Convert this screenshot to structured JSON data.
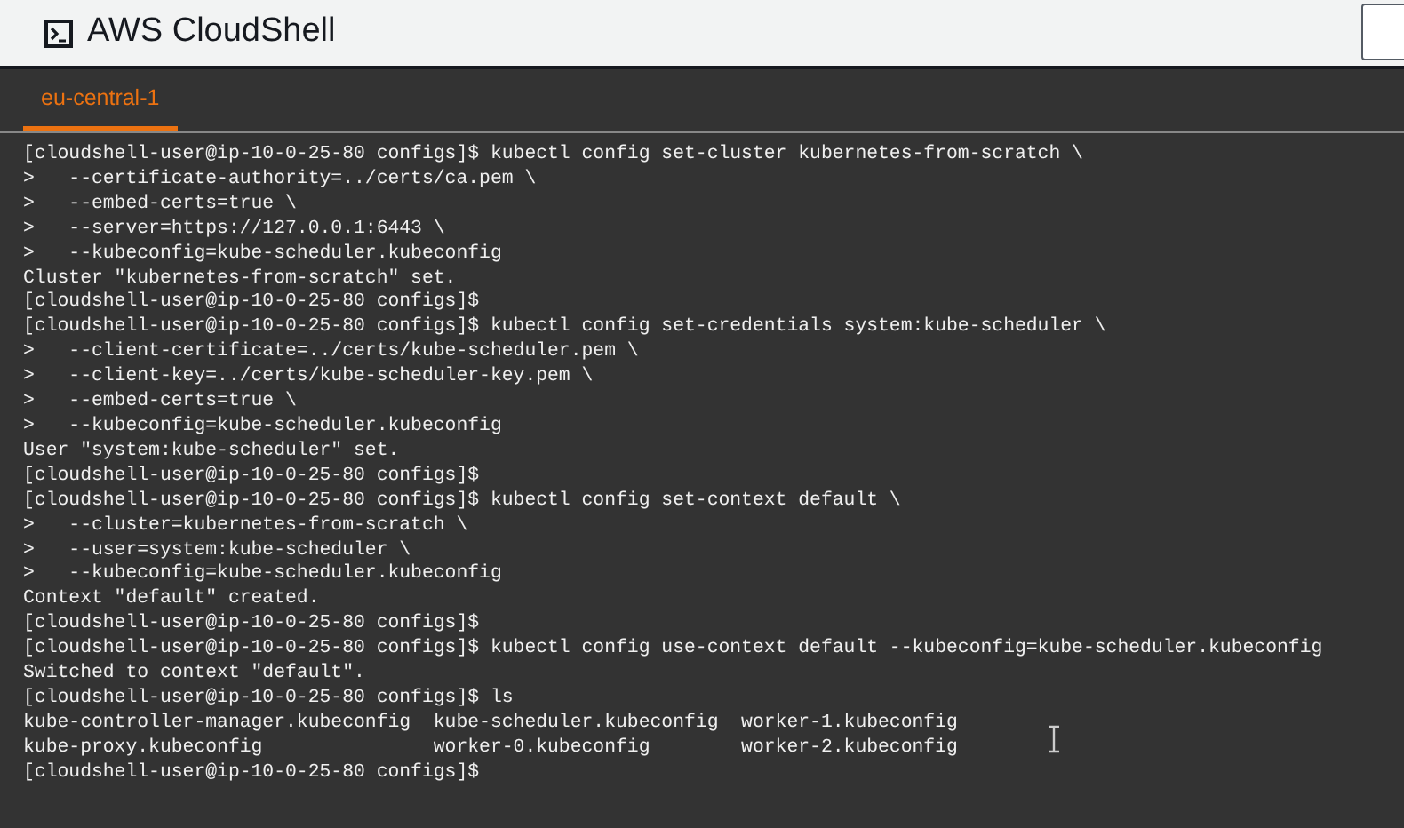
{
  "header": {
    "title": "AWS CloudShell"
  },
  "tabs": [
    {
      "label": "eu-central-1",
      "selected": true
    }
  ],
  "terminal": {
    "lines": [
      "[cloudshell-user@ip-10-0-25-80 configs]$ kubectl config set-cluster kubernetes-from-scratch \\",
      ">   --certificate-authority=../certs/ca.pem \\",
      ">   --embed-certs=true \\",
      ">   --server=https://127.0.0.1:6443 \\",
      ">   --kubeconfig=kube-scheduler.kubeconfig",
      "Cluster \"kubernetes-from-scratch\" set.",
      "[cloudshell-user@ip-10-0-25-80 configs]$",
      "[cloudshell-user@ip-10-0-25-80 configs]$ kubectl config set-credentials system:kube-scheduler \\",
      ">   --client-certificate=../certs/kube-scheduler.pem \\",
      ">   --client-key=../certs/kube-scheduler-key.pem \\",
      ">   --embed-certs=true \\",
      ">   --kubeconfig=kube-scheduler.kubeconfig",
      "User \"system:kube-scheduler\" set.",
      "[cloudshell-user@ip-10-0-25-80 configs]$",
      "[cloudshell-user@ip-10-0-25-80 configs]$ kubectl config set-context default \\",
      ">   --cluster=kubernetes-from-scratch \\",
      ">   --user=system:kube-scheduler \\",
      ">   --kubeconfig=kube-scheduler.kubeconfig",
      "Context \"default\" created.",
      "[cloudshell-user@ip-10-0-25-80 configs]$",
      "[cloudshell-user@ip-10-0-25-80 configs]$ kubectl config use-context default --kubeconfig=kube-scheduler.kubeconfig",
      "Switched to context \"default\".",
      "[cloudshell-user@ip-10-0-25-80 configs]$ ls",
      "kube-controller-manager.kubeconfig  kube-scheduler.kubeconfig  worker-1.kubeconfig",
      "kube-proxy.kubeconfig               worker-0.kubeconfig        worker-2.kubeconfig",
      "[cloudshell-user@ip-10-0-25-80 configs]$"
    ]
  }
}
